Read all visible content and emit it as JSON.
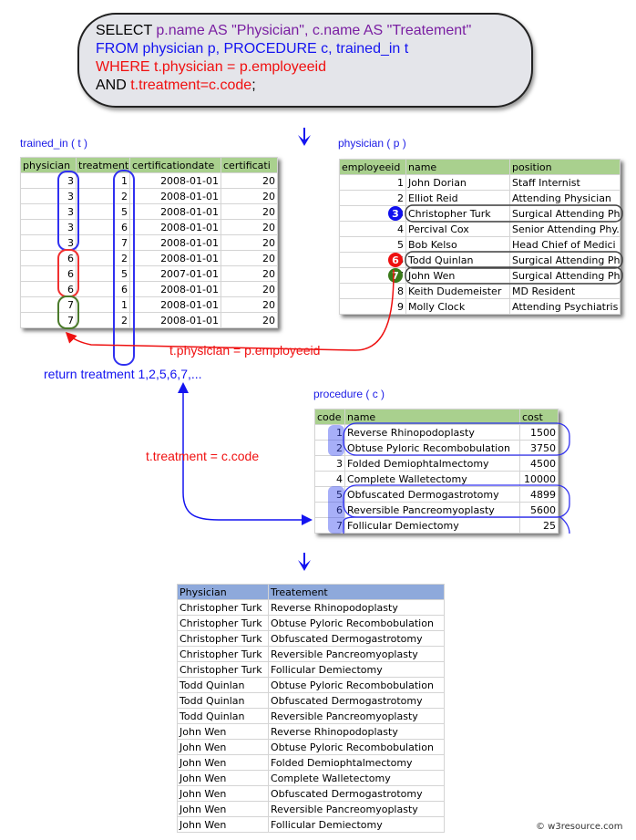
{
  "sql": {
    "line1": [
      {
        "t": "SELECT ",
        "c": "k"
      },
      {
        "t": "p.name AS \"Physician\", c.name AS \"Treatement\"",
        "c": "p"
      }
    ],
    "line2": [
      {
        "t": "FROM physician p, PROCEDURE c, trained_in t",
        "c": "b"
      }
    ],
    "line3": [
      {
        "t": "WHERE t.physician = p.employeeid",
        "c": "r"
      }
    ],
    "line4": [
      {
        "t": "AND ",
        "c": "k"
      },
      {
        "t": "t.treatment=c.code",
        "c": "r"
      },
      {
        "t": ";",
        "c": "k"
      }
    ]
  },
  "trained_in": {
    "label": "trained_in ( t )",
    "columns": [
      "physician",
      "treatment",
      "certificationdate",
      "certificati"
    ],
    "rows": [
      [
        "3",
        "1",
        "2008-01-01",
        "20"
      ],
      [
        "3",
        "2",
        "2008-01-01",
        "20"
      ],
      [
        "3",
        "5",
        "2008-01-01",
        "20"
      ],
      [
        "3",
        "6",
        "2008-01-01",
        "20"
      ],
      [
        "3",
        "7",
        "2008-01-01",
        "20"
      ],
      [
        "6",
        "2",
        "2008-01-01",
        "20"
      ],
      [
        "6",
        "5",
        "2007-01-01",
        "20"
      ],
      [
        "6",
        "6",
        "2008-01-01",
        "20"
      ],
      [
        "7",
        "1",
        "2008-01-01",
        "20"
      ],
      [
        "7",
        "2",
        "2008-01-01",
        "20"
      ]
    ]
  },
  "physician": {
    "label": "physician ( p )",
    "columns": [
      "employeeid",
      "name",
      "position"
    ],
    "rows": [
      [
        "1",
        "John Dorian",
        "Staff Internist"
      ],
      [
        "2",
        "Elliot Reid",
        "Attending Physician"
      ],
      [
        "3",
        "Christopher Turk",
        "Surgical Attending Ph"
      ],
      [
        "4",
        "Percival Cox",
        "Senior Attending Phy."
      ],
      [
        "5",
        "Bob Kelso",
        "Head Chief of Medici"
      ],
      [
        "6",
        "Todd Quinlan",
        "Surgical Attending Ph"
      ],
      [
        "7",
        "John Wen",
        "Surgical Attending Ph"
      ],
      [
        "8",
        "Keith Dudemeister",
        "MD Resident"
      ],
      [
        "9",
        "Molly Clock",
        "Attending Psychiatris"
      ]
    ],
    "markers": [
      {
        "id": "3",
        "color": "#1010ee"
      },
      {
        "id": "6",
        "color": "#ee1010"
      },
      {
        "id": "7",
        "color": "#3a7a1a"
      }
    ]
  },
  "procedure": {
    "label": "procedure ( c )",
    "columns": [
      "code",
      "name",
      "cost"
    ],
    "rows": [
      [
        "1",
        "Reverse Rhinopodoplasty",
        "1500"
      ],
      [
        "2",
        "Obtuse Pyloric Recombobulation",
        "3750"
      ],
      [
        "3",
        "Folded Demiophtalmectomy",
        "4500"
      ],
      [
        "4",
        "Complete Walletectomy",
        "10000"
      ],
      [
        "5",
        "Obfuscated Dermogastrotomy",
        "4899"
      ],
      [
        "6",
        "Reversible Pancreomyoplasty",
        "5600"
      ],
      [
        "7",
        "Follicular Demiectomy",
        "25"
      ]
    ]
  },
  "annotations": {
    "join1": "t.physician = p.employeeid",
    "returns": "return treatment 1,2,5,6,7,...",
    "join2": "t.treatment = c.code"
  },
  "result": {
    "columns": [
      "Physician",
      "Treatement"
    ],
    "rows": [
      [
        "Christopher Turk",
        "Reverse Rhinopodoplasty"
      ],
      [
        "Christopher Turk",
        "Obtuse Pyloric Recombobulation"
      ],
      [
        "Christopher Turk",
        "Obfuscated Dermogastrotomy"
      ],
      [
        "Christopher Turk",
        "Reversible Pancreomyoplasty"
      ],
      [
        "Christopher Turk",
        "Follicular Demiectomy"
      ],
      [
        "Todd Quinlan",
        "Obtuse Pyloric Recombobulation"
      ],
      [
        "Todd Quinlan",
        "Obfuscated Dermogastrotomy"
      ],
      [
        "Todd Quinlan",
        "Reversible Pancreomyoplasty"
      ],
      [
        "John Wen",
        "Reverse Rhinopodoplasty"
      ],
      [
        "John Wen",
        "Obtuse Pyloric Recombobulation"
      ],
      [
        "John Wen",
        "Folded Demiophtalmectomy"
      ],
      [
        "John Wen",
        "Complete Walletectomy"
      ],
      [
        "John Wen",
        "Obfuscated Dermogastrotomy"
      ],
      [
        "John Wen",
        "Reversible Pancreomyoplasty"
      ],
      [
        "John Wen",
        "Follicular Demiectomy"
      ]
    ]
  },
  "footer": "© w3resource.com"
}
